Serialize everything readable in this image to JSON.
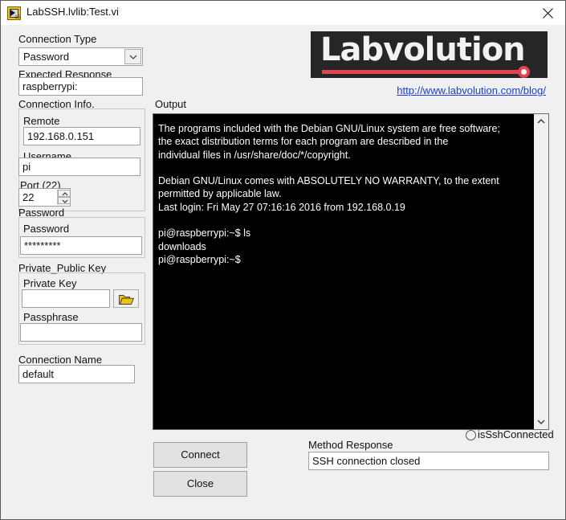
{
  "window": {
    "title": "LabSSH.lvlib:Test.vi",
    "icon": "labview-vi-icon",
    "close_icon": "close-icon",
    "bg_color": "#f0f0f0"
  },
  "form": {
    "connection_type": {
      "label": "Connection Type",
      "value": "Password",
      "options": [
        "Password",
        "Private_Public Key"
      ],
      "arrow_icon": "chevron-down-icon"
    },
    "expected_response": {
      "label": "Expected Response",
      "value": "raspberrypi:",
      "placeholder": ""
    },
    "connection_info": {
      "label": "Connection Info.",
      "remote": {
        "label": "Remote",
        "value": "192.168.0.151"
      },
      "username": {
        "label": "Username",
        "value": "pi"
      },
      "port": {
        "label": "Port (22)",
        "value": "22"
      }
    },
    "password_group": {
      "label": "Password",
      "password": {
        "label": "Password",
        "value": "*********"
      }
    },
    "private_public_key": {
      "label": "Private_Public Key",
      "private_key": {
        "label": "Private Key",
        "value": ""
      },
      "browse_icon": "folder-open-icon",
      "passphrase": {
        "label": "Passphrase",
        "value": ""
      }
    },
    "connection_name": {
      "label": "Connection Name",
      "value": "default"
    }
  },
  "brand": {
    "logo_text": "Labvolution",
    "logo_bg": "#262626",
    "accent_color": "#e04452",
    "link": "http://www.labvolution.com/blog/",
    "link_color": "#1b3fd4"
  },
  "output": {
    "label": "Output",
    "bg_color": "#000000",
    "text_color": "#ffffff",
    "scroll_up_icon": "chevron-up-icon",
    "scroll_down_icon": "chevron-down-icon",
    "text": "The programs included with the Debian GNU/Linux system are free software;\nthe exact distribution terms for each program are described in the\nindividual files in /usr/share/doc/*/copyright.\n\nDebian GNU/Linux comes with ABSOLUTELY NO WARRANTY, to the extent\npermitted by applicable law.\nLast login: Fri May 27 07:16:16 2016 from 192.168.0.19\n\npi@raspberrypi:~$ ls\ndownloads\npi@raspberrypi:~$"
  },
  "status": {
    "led_label": "isSshConnected",
    "led_state": "off",
    "method_response_label": "Method Response",
    "method_response_value": "SSH connection closed"
  },
  "actions": {
    "connect": "Connect",
    "close": "Close"
  }
}
